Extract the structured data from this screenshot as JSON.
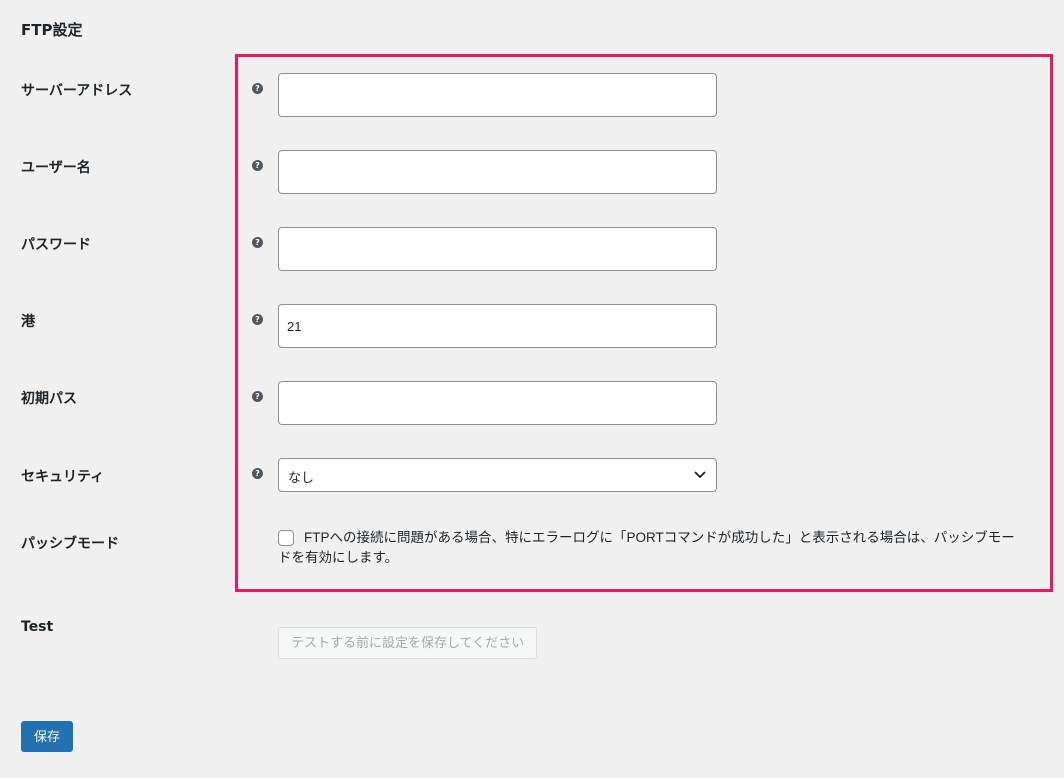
{
  "section_title": "FTP設定",
  "fields": {
    "server_address": {
      "label": "サーバーアドレス",
      "value": ""
    },
    "username": {
      "label": "ユーザー名",
      "value": ""
    },
    "password": {
      "label": "パスワード",
      "value": ""
    },
    "port": {
      "label": "港",
      "value": "21"
    },
    "initial_path": {
      "label": "初期パス",
      "value": ""
    },
    "security": {
      "label": "セキュリティ",
      "selected": "なし"
    },
    "passive_mode": {
      "label": "パッシブモード",
      "checked": false,
      "description": "FTPへの接続に問題がある場合、特にエラーログに「PORTコマンドが成功した」と表示される場合は、パッシブモードを有効にします。"
    }
  },
  "test": {
    "label": "Test",
    "button_label": "テストする前に設定を保存してください"
  },
  "save_button_label": "保存",
  "icons": {
    "help": "question-circle-icon",
    "dropdown": "chevron-down-icon"
  },
  "colors": {
    "highlight": "#e8185a",
    "primary": "#2271b1",
    "background": "#f0f0f1"
  }
}
